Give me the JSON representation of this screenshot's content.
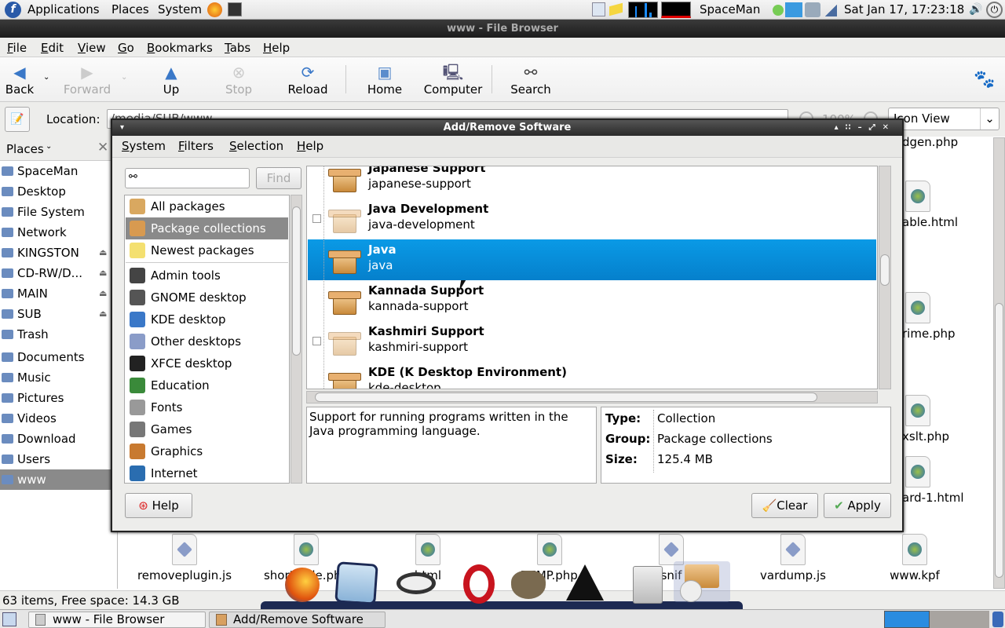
{
  "top_panel": {
    "menus": [
      "Applications",
      "Places",
      "System"
    ],
    "user": "SpaceMan",
    "clock": "Sat Jan 17, 17:23:18"
  },
  "file_browser": {
    "title": "www - File Browser",
    "menu": [
      "File",
      "Edit",
      "View",
      "Go",
      "Bookmarks",
      "Tabs",
      "Help"
    ],
    "toolbar": {
      "back": "Back",
      "forward": "Forward",
      "up": "Up",
      "stop": "Stop",
      "reload": "Reload",
      "home": "Home",
      "computer": "Computer",
      "search": "Search"
    },
    "location_label": "Location:",
    "location_value": "/media/SUB/www",
    "zoom": "100%",
    "view_mode": "Icon View",
    "places_header": "Places",
    "places": [
      "SpaceMan",
      "Desktop",
      "File System",
      "Network",
      "KINGSTON",
      "CD-RW/D...",
      "MAIN",
      "SUB",
      "Trash",
      "Documents",
      "Music",
      "Pictures",
      "Videos",
      "Download",
      "Users",
      "www"
    ],
    "selected_place": "www",
    "files_right": [
      "dgen.php",
      "able.html",
      "rime.php",
      "xslt.php",
      "ard-1.html"
    ],
    "files_bottom": [
      "removeplugin.js",
      "shortcode.php",
      "html",
      "TEMP.php",
      "snif",
      "vardump.js",
      "www.kpf"
    ],
    "status": "63 items, Free space: 14.3 GB"
  },
  "dialog": {
    "title": "Add/Remove Software",
    "menu": [
      "System",
      "Filters",
      "Selection",
      "Help"
    ],
    "search_value": "",
    "find_label": "Find",
    "categories": [
      "All packages",
      "Package collections",
      "Newest packages",
      "Admin tools",
      "GNOME desktop",
      "KDE desktop",
      "Other desktops",
      "XFCE desktop",
      "Education",
      "Fonts",
      "Games",
      "Graphics",
      "Internet"
    ],
    "selected_category": "Package collections",
    "packages": [
      {
        "name": "Japanese Support",
        "id": "japanese-support",
        "installed": true
      },
      {
        "name": "Java Development",
        "id": "java-development",
        "installed": false
      },
      {
        "name": "Java",
        "id": "java",
        "installed": true
      },
      {
        "name": "Kannada Support",
        "id": "kannada-support",
        "installed": true
      },
      {
        "name": "Kashmiri Support",
        "id": "kashmiri-support",
        "installed": false
      },
      {
        "name": "KDE (K Desktop Environment)",
        "id": "kde-desktop",
        "installed": true
      }
    ],
    "selected_package": "Java",
    "description": "Support for running programs written in the Java programming language.",
    "details": [
      {
        "label": "Type:",
        "value": "Collection"
      },
      {
        "label": "Group:",
        "value": "Package collections"
      },
      {
        "label": "Size:",
        "value": "125.4 MB"
      }
    ],
    "help_label": "Help",
    "clear_label": "Clear",
    "apply_label": "Apply"
  },
  "taskbar": [
    "www - File Browser",
    "Add/Remove Software"
  ],
  "colors": {
    "selection": "#0a8ed8",
    "title_bar": "#2a2a2a"
  }
}
